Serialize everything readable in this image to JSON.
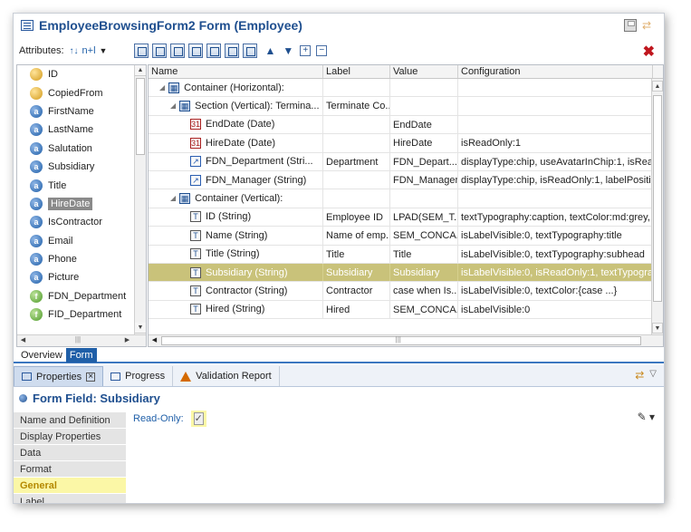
{
  "window": {
    "title": "EmployeeBrowsingForm2 Form (Employee)"
  },
  "toolbar": {
    "attributes_label": "Attributes:",
    "sort_label": "n+l"
  },
  "attributes": [
    {
      "label": "ID",
      "icon": "key-icon"
    },
    {
      "label": "CopiedFrom",
      "icon": "key-icon"
    },
    {
      "label": "FirstName",
      "icon": "attribute-icon"
    },
    {
      "label": "LastName",
      "icon": "attribute-icon"
    },
    {
      "label": "Salutation",
      "icon": "attribute-icon"
    },
    {
      "label": "Subsidiary",
      "icon": "attribute-icon"
    },
    {
      "label": "Title",
      "icon": "attribute-icon"
    },
    {
      "label": "HireDate",
      "icon": "attribute-icon",
      "selected": true
    },
    {
      "label": "IsContractor",
      "icon": "attribute-icon"
    },
    {
      "label": "Email",
      "icon": "attribute-icon"
    },
    {
      "label": "Phone",
      "icon": "attribute-icon"
    },
    {
      "label": "Picture",
      "icon": "attribute-icon"
    },
    {
      "label": "FDN_Department",
      "icon": "foreign-key-icon"
    },
    {
      "label": "FID_Department",
      "icon": "foreign-key-icon"
    }
  ],
  "grid": {
    "columns": [
      "Name",
      "Label",
      "Value",
      "Configuration"
    ],
    "rows": [
      {
        "indent": 1,
        "twisty": "◢",
        "icon": "container",
        "name": "Container (Horizontal):",
        "label": "",
        "value": "",
        "config": ""
      },
      {
        "indent": 2,
        "twisty": "◢",
        "icon": "container",
        "name": "Section (Vertical): Termina...",
        "label": "Terminate Co...",
        "value": "",
        "config": ""
      },
      {
        "indent": 3,
        "twisty": "",
        "icon": "date",
        "name": "EndDate (Date)",
        "label": "",
        "value": "EndDate",
        "config": ""
      },
      {
        "indent": 3,
        "twisty": "",
        "icon": "date",
        "name": "HireDate (Date)",
        "label": "",
        "value": "HireDate",
        "config": "isReadOnly:1"
      },
      {
        "indent": 3,
        "twisty": "",
        "icon": "link",
        "name": "FDN_Department (Stri...",
        "label": "Department",
        "value": "FDN_Depart...",
        "config": "displayType:chip, useAvatarInChip:1, isReadOn"
      },
      {
        "indent": 3,
        "twisty": "",
        "icon": "link",
        "name": "FDN_Manager (String)",
        "label": "",
        "value": "FDN_Manager",
        "config": "displayType:chip, isReadOnly:1, labelPosition:t."
      },
      {
        "indent": 2,
        "twisty": "◢",
        "icon": "container",
        "name": "Container (Vertical):",
        "label": "",
        "value": "",
        "config": ""
      },
      {
        "indent": 3,
        "twisty": "",
        "icon": "text",
        "name": "ID (String)",
        "label": "Employee ID",
        "value": "LPAD(SEM_T...",
        "config": "textTypography:caption, textColor:md:grey, isL"
      },
      {
        "indent": 3,
        "twisty": "",
        "icon": "text",
        "name": "Name (String)",
        "label": "Name of emp...",
        "value": "SEM_CONCA...",
        "config": "isLabelVisible:0, textTypography:title"
      },
      {
        "indent": 3,
        "twisty": "",
        "icon": "text",
        "name": "Title (String)",
        "label": "Title",
        "value": "Title",
        "config": "isLabelVisible:0, textTypography:subhead"
      },
      {
        "indent": 3,
        "twisty": "",
        "icon": "text",
        "name": "Subsidiary (String)",
        "label": "Subsidiary",
        "value": "Subsidiary",
        "config": "isLabelVisible:0, isReadOnly:1, textTypography.",
        "highlight": true
      },
      {
        "indent": 3,
        "twisty": "",
        "icon": "text",
        "name": "Contractor (String)",
        "label": "Contractor",
        "value": "case when Is...",
        "config": "isLabelVisible:0, textColor:{case ...}"
      },
      {
        "indent": 3,
        "twisty": "",
        "icon": "text",
        "name": "Hired (String)",
        "label": "Hired",
        "value": "SEM_CONCA...",
        "config": "isLabelVisible:0"
      }
    ]
  },
  "view_tabs": [
    {
      "label": "Overview",
      "active": false
    },
    {
      "label": "Form",
      "active": true
    }
  ],
  "properties_tabs": [
    {
      "label": "Properties",
      "active": true
    },
    {
      "label": "Progress",
      "active": false
    },
    {
      "label": "Validation Report",
      "active": false
    }
  ],
  "form_field": {
    "title": "Form Field: Subsidiary"
  },
  "side_nav": [
    {
      "label": "Name and Definition",
      "active": false
    },
    {
      "label": "Display Properties",
      "active": false
    },
    {
      "label": "Data",
      "active": false
    },
    {
      "label": "Format",
      "active": false
    },
    {
      "label": "General",
      "active": true
    },
    {
      "label": "Label",
      "active": false
    }
  ],
  "general": {
    "readonly_label": "Read-Only:",
    "readonly_checked": true
  },
  "colors": {
    "accent": "#1f5fa8",
    "highlight_row": "#c9c27a",
    "active_nav": "#fbf7a6",
    "close_red": "#c0171e"
  }
}
